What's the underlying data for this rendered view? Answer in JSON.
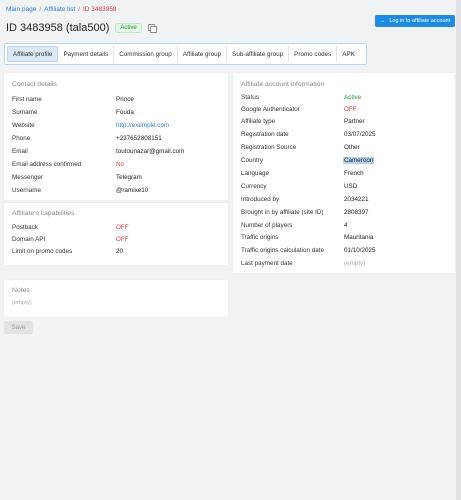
{
  "breadcrumb": {
    "main": "Main page",
    "list": "Affiliate list",
    "current": "ID 3483958",
    "sep": "/"
  },
  "header": {
    "title": "ID 3483958 (tala500)",
    "status": "Active",
    "login_button": "Log in to affiliate account",
    "login_arrow": "→"
  },
  "tabs": [
    {
      "label": "Affiliate profile",
      "active": true
    },
    {
      "label": "Payment details"
    },
    {
      "label": "Commission group"
    },
    {
      "label": "Affiliate group"
    },
    {
      "label": "Sub-affiliate group"
    },
    {
      "label": "Promo codes"
    },
    {
      "label": "APK"
    }
  ],
  "contact": {
    "title": "Contact details",
    "rows": [
      {
        "k": "First name",
        "v": "Prince"
      },
      {
        "k": "Surname",
        "v": "Fouda"
      },
      {
        "k": "Website",
        "v": "http://exemple.com"
      },
      {
        "k": "Phone",
        "v": "+237652808151"
      },
      {
        "k": "Email",
        "v": "toutounazar@gmail.com"
      },
      {
        "k": "Email address confirmed",
        "v": "No"
      },
      {
        "k": "Messenger",
        "v": "Telegram"
      },
      {
        "k": "Username",
        "v": "@ramixe10"
      }
    ]
  },
  "capabilities": {
    "title": "Affiliate's capabilities",
    "rows": [
      {
        "k": "Postback",
        "v": "OFF"
      },
      {
        "k": "Domain API",
        "v": "OFF"
      },
      {
        "k": "Limit on promo codes",
        "v": "20"
      }
    ]
  },
  "notes": {
    "title": "Notes",
    "empty": "(empty)"
  },
  "save_label": "Save",
  "account": {
    "title": "Affiliate account information",
    "rows": [
      {
        "k": "Status",
        "v": "Active"
      },
      {
        "k": "Google Authenticator",
        "v": "OFF"
      },
      {
        "k": "Affiliate type",
        "v": "Partner"
      },
      {
        "k": "Registration date",
        "v": "03/07/2025"
      },
      {
        "k": "Registration Source",
        "v": "Other"
      },
      {
        "k": "Country",
        "v": "Cameroon"
      },
      {
        "k": "Language",
        "v": "French"
      },
      {
        "k": "Currency",
        "v": "USD"
      },
      {
        "k": "Introduced by",
        "v": "2034221"
      },
      {
        "k": "Brought in by affiliate (site ID)",
        "v": "2808397"
      },
      {
        "k": "Number of players",
        "v": "4"
      },
      {
        "k": "Traffic origins",
        "v": "Mauritania"
      },
      {
        "k": "Traffic origins calculation date",
        "v": "01/10/2025"
      },
      {
        "k": "Last payment date",
        "v": "(empty)"
      }
    ]
  },
  "colors": {
    "accent": "#1e8be0",
    "off": "#e33b3b",
    "active": "#1c9b3a",
    "link": "#2c7fd1"
  }
}
